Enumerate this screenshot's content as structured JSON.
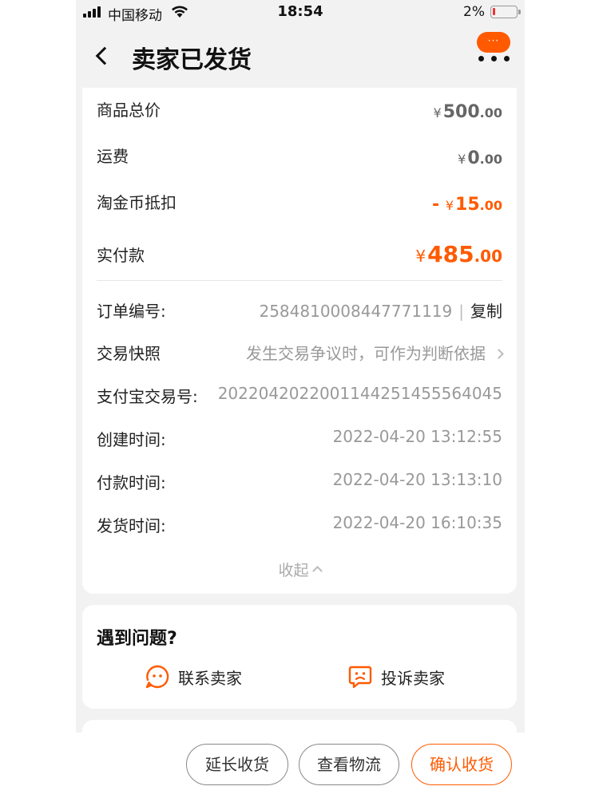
{
  "status_bar": {
    "carrier": "中国移动",
    "time": "18:54",
    "battery": "2%"
  },
  "nav": {
    "title": "卖家已发货",
    "more_icon_text": "···"
  },
  "price_summary": {
    "goods_total": {
      "label": "商品总价",
      "yen": "¥",
      "int": "500",
      "dec": ".00"
    },
    "shipping": {
      "label": "运费",
      "yen": "¥",
      "int": "0",
      "dec": ".00"
    },
    "coin_discount": {
      "label": "淘金币抵扣",
      "prefix": "- ",
      "yen": "¥",
      "int": "15",
      "dec": ".00"
    },
    "paid": {
      "label": "实付款",
      "yen": "¥",
      "int": "485",
      "dec": ".00"
    }
  },
  "order_info": {
    "order_no": {
      "label": "订单编号:",
      "value": "2584810008447771119",
      "separator": "|",
      "copy": "复制"
    },
    "snapshot": {
      "label": "交易快照",
      "value": "发生交易争议时，可作为判断依据"
    },
    "alipay_no": {
      "label": "支付宝交易号:",
      "value": "2022042022001144251455564045"
    },
    "created": {
      "label": "创建时间:",
      "value": "2022-04-20 13:12:55"
    },
    "paid_time": {
      "label": "付款时间:",
      "value": "2022-04-20 13:13:10"
    },
    "shipped": {
      "label": "发货时间:",
      "value": "2022-04-20 16:10:35"
    },
    "collapse": "收起"
  },
  "help": {
    "title": "遇到问题?",
    "contact_seller": "联系卖家",
    "complain_seller": "投诉卖家"
  },
  "actions": {
    "extend": "延长收货",
    "logistics": "查看物流",
    "confirm": "确认收货"
  },
  "colors": {
    "accent": "#ff5a00",
    "muted": "#999999",
    "background": "#f2f2f2"
  }
}
